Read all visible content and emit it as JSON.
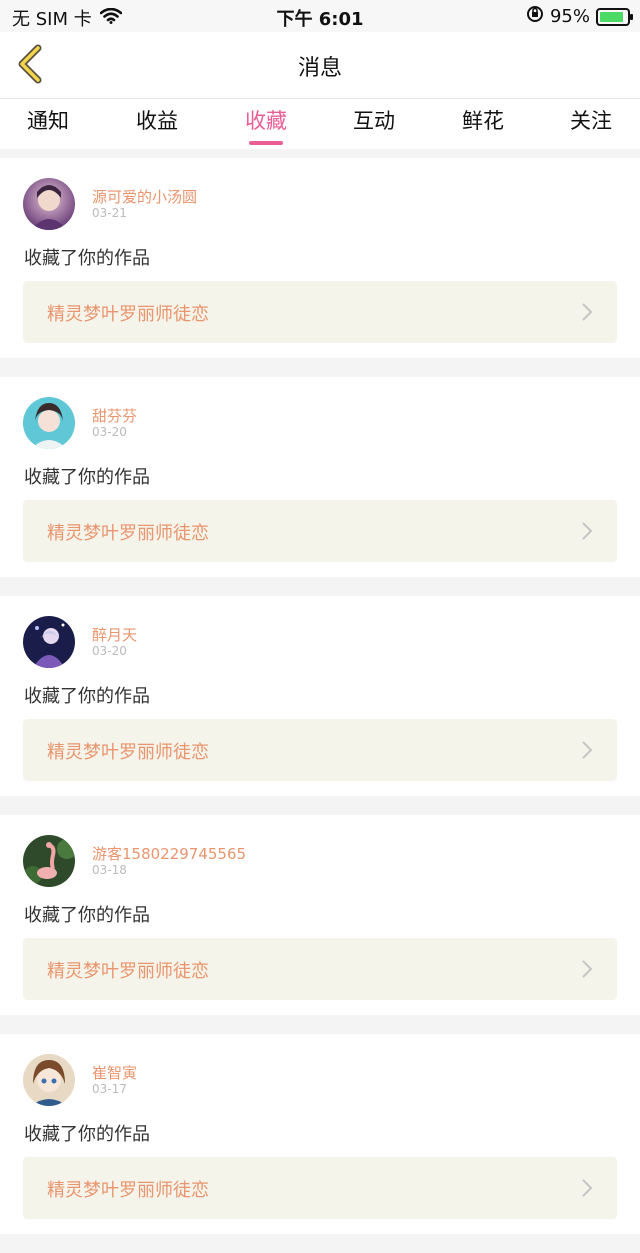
{
  "status": {
    "carrier": "无 SIM 卡",
    "time": "下午 6:01",
    "battery": "95%",
    "battery_level": 0.95
  },
  "nav": {
    "back_icon": "chevron-left-icon",
    "title": "消息"
  },
  "tabs": [
    {
      "label": "通知"
    },
    {
      "label": "收益"
    },
    {
      "label": "收藏"
    },
    {
      "label": "互动"
    },
    {
      "label": "鲜花"
    },
    {
      "label": "关注"
    }
  ],
  "active_tab": "收藏",
  "colors": {
    "accent": "#ea5e95",
    "name": "#e9956d",
    "work_bg": "#f5f4eb"
  },
  "items": [
    {
      "user": "源可爱的小汤圆",
      "date": "03-21",
      "action": "收藏了你的作品",
      "work": "精灵梦叶罗丽师徒恋"
    },
    {
      "user": "甜芬芬",
      "date": "03-20",
      "action": "收藏了你的作品",
      "work": "精灵梦叶罗丽师徒恋"
    },
    {
      "user": "醉月天",
      "date": "03-20",
      "action": "收藏了你的作品",
      "work": "精灵梦叶罗丽师徒恋"
    },
    {
      "user": "游客1580229745565",
      "date": "03-18",
      "action": "收藏了你的作品",
      "work": "精灵梦叶罗丽师徒恋"
    },
    {
      "user": "崔智寅",
      "date": "03-17",
      "action": "收藏了你的作品",
      "work": "精灵梦叶罗丽师徒恋"
    }
  ]
}
